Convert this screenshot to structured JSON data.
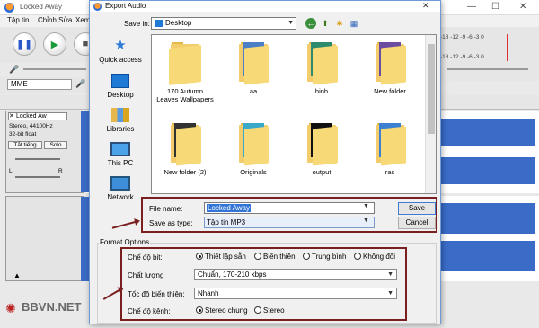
{
  "audacity": {
    "title": "Locked Away",
    "menu": [
      "Tập tin",
      "Chỉnh Sửa",
      "Xem"
    ],
    "device": "MME",
    "meter_scale": "-18 -12 -9 -6 -3 0",
    "track": {
      "name": "Locked Aw",
      "info_line1": "Stereo, 44100Hz",
      "info_line2": "32-bit float",
      "mute_label": "Tắt tiếng",
      "solo_label": "Solo",
      "left": "L",
      "right": "R"
    },
    "watermark": "BBVN.NET"
  },
  "dialog": {
    "title": "Export Audio",
    "save_in_label": "Save in:",
    "save_in_value": "Desktop",
    "places": [
      "Quick access",
      "Desktop",
      "Libraries",
      "This PC",
      "Network"
    ],
    "files": [
      {
        "name": "170 Autumn Leaves Wallpapers",
        "paper": "none"
      },
      {
        "name": "aa",
        "paper": "#4a7fc8"
      },
      {
        "name": "hinh",
        "paper": "#2e8a6d"
      },
      {
        "name": "New folder",
        "paper": "#6a4ca0"
      },
      {
        "name": "New folder (2)",
        "paper": "#333333"
      },
      {
        "name": "Originals",
        "paper": "#3aa8c8"
      },
      {
        "name": "output",
        "paper": "#111111"
      },
      {
        "name": "rac",
        "paper": "#3d7fd0"
      }
    ],
    "file_name_label": "File name:",
    "file_name_value": "Locked Away",
    "save_as_type_label": "Save as type:",
    "save_as_type_value": "Tập tin MP3",
    "save_button": "Save",
    "cancel_button": "Cancel",
    "format_options_label": "Format Options",
    "bitrate_mode_label": "Chế độ bit:",
    "bitrate_modes": [
      "Thiết lập sẵn",
      "Biến thiên",
      "Trung bình",
      "Không đổi"
    ],
    "bitrate_mode_selected": 0,
    "quality_label": "Chất lượng",
    "quality_value": "Chuẩn, 170-210 kbps",
    "variable_speed_label": "Tốc độ biến thiên:",
    "variable_speed_value": "Nhanh",
    "channel_mode_label": "Chế độ kênh:",
    "channel_modes": [
      "Stereo chung",
      "Stereo"
    ],
    "channel_mode_selected": 0
  },
  "colors": {
    "highlight": "#7a1f1f",
    "selection": "#3375d7",
    "waveform": "#3a6bc7"
  }
}
